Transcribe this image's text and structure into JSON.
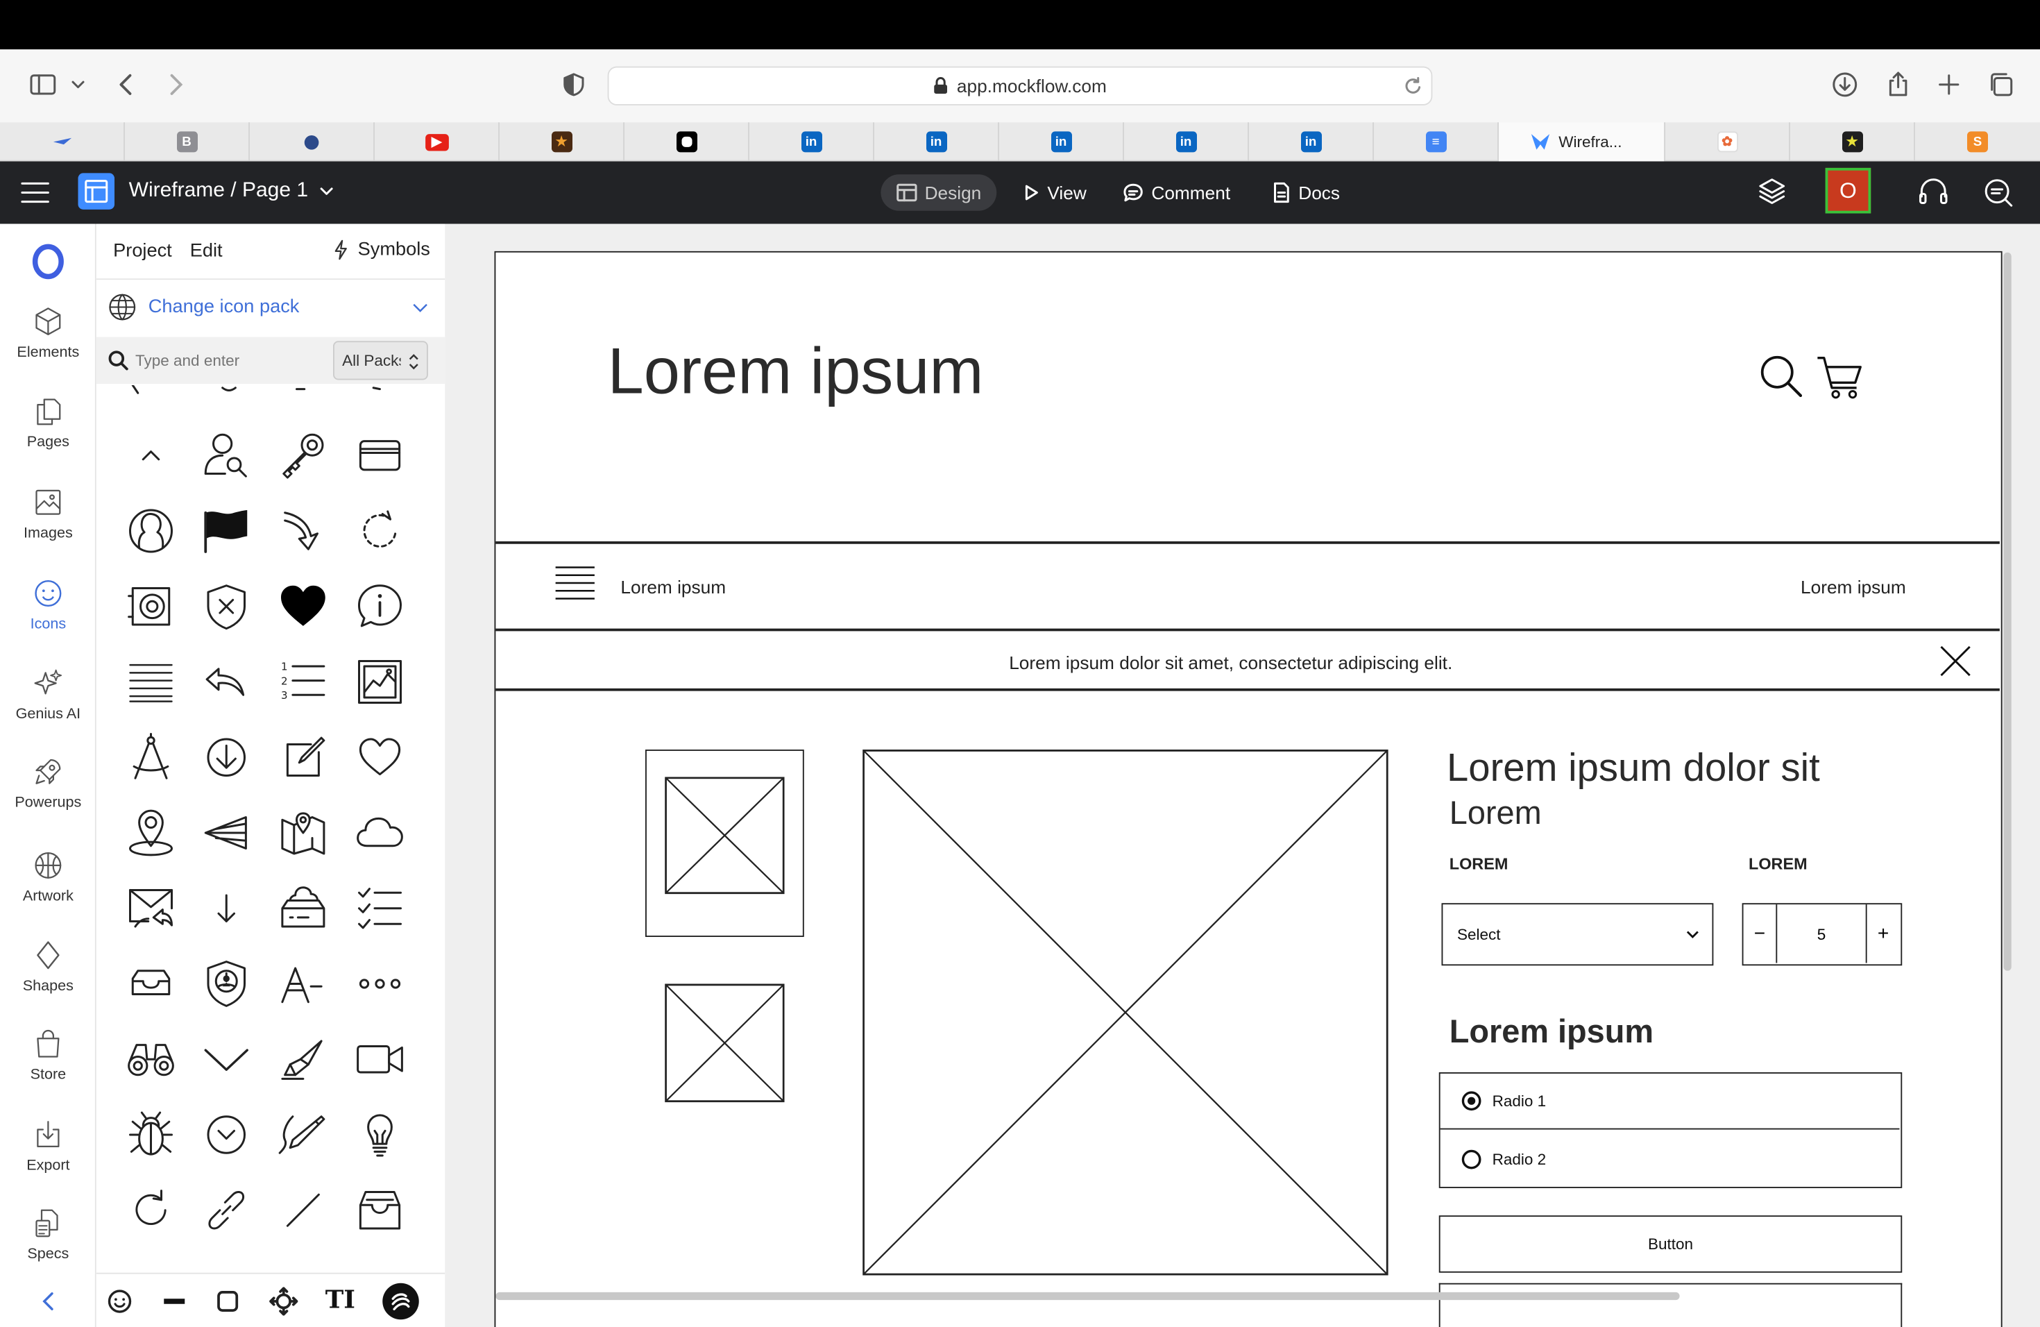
{
  "browser": {
    "url": "app.mockflow.com",
    "tabs": [
      {
        "icon": "mockflow-bird-icon",
        "label": "",
        "color": "#3b6bd6"
      },
      {
        "icon": "b-letter-icon",
        "label": "",
        "color": "#8e8e93"
      },
      {
        "icon": "dot-icon",
        "label": "",
        "color": "#2c4a8a"
      },
      {
        "icon": "youtube-icon",
        "label": "",
        "color": "#e62117"
      },
      {
        "icon": "star-app-icon",
        "label": "",
        "color": "#4a2a12"
      },
      {
        "icon": "chat-bubble-app-icon",
        "label": "",
        "color": "#000000"
      },
      {
        "icon": "linkedin-icon",
        "label": "",
        "color": "#0a66c2"
      },
      {
        "icon": "linkedin-icon",
        "label": "",
        "color": "#0a66c2"
      },
      {
        "icon": "linkedin-icon",
        "label": "",
        "color": "#0a66c2"
      },
      {
        "icon": "linkedin-icon",
        "label": "",
        "color": "#0a66c2"
      },
      {
        "icon": "linkedin-icon",
        "label": "",
        "color": "#0a66c2"
      },
      {
        "icon": "google-docs-icon",
        "label": "",
        "color": "#4285f4"
      },
      {
        "icon": "mockflow-icon",
        "label": "Wirefra...",
        "color": "#3f8cff"
      },
      {
        "icon": "image-app-icon",
        "label": "",
        "color": "#e86a3a"
      },
      {
        "icon": "star-app-icon",
        "label": "",
        "color": "#1f1f1f"
      },
      {
        "icon": "s-letter-icon",
        "label": "",
        "color": "#f28c28"
      }
    ]
  },
  "app": {
    "title": "Wireframe / Page 1",
    "nav": {
      "design": "Design",
      "view": "View",
      "comment": "Comment",
      "docs": "Docs"
    },
    "avatar": "O",
    "accent": "#3f8cff"
  },
  "rail": {
    "items": [
      {
        "label": "Elements",
        "icon": "cube-icon"
      },
      {
        "label": "Pages",
        "icon": "pages-icon"
      },
      {
        "label": "Images",
        "icon": "image-icon"
      },
      {
        "label": "Icons",
        "icon": "smiley-icon",
        "active": true
      },
      {
        "label": "Genius AI",
        "icon": "sparkle-icon"
      },
      {
        "label": "Powerups",
        "icon": "rocket-icon"
      },
      {
        "label": "Artwork",
        "icon": "basketball-icon"
      },
      {
        "label": "Shapes",
        "icon": "diamond-icon"
      },
      {
        "label": "Store",
        "icon": "shopping-bag-icon"
      },
      {
        "label": "Export",
        "icon": "export-icon"
      },
      {
        "label": "Specs",
        "icon": "specs-icon"
      }
    ]
  },
  "panel": {
    "tabs": {
      "project": "Project",
      "edit": "Edit",
      "symbols": "Symbols"
    },
    "change_pack": "Change icon pack",
    "search_placeholder": "Type and enter",
    "pack_select": "All Packs"
  },
  "wireframe": {
    "header_title": "Lorem ipsum",
    "nav_left": "Lorem ipsum",
    "nav_right": "Lorem ipsum",
    "banner": "Lorem ipsum dolor sit amet, consectetur adipiscing elit.",
    "product_title": "Lorem ipsum dolor sit",
    "product_subtitle": "Lorem",
    "label_a": "LOREM",
    "label_b": "LOREM",
    "select_value": "Select",
    "quantity": "5",
    "stepper_minus": "−",
    "stepper_plus": "+",
    "section_title": "Lorem ipsum",
    "radio1": "Radio 1",
    "radio2": "Radio 2",
    "button": "Button"
  }
}
